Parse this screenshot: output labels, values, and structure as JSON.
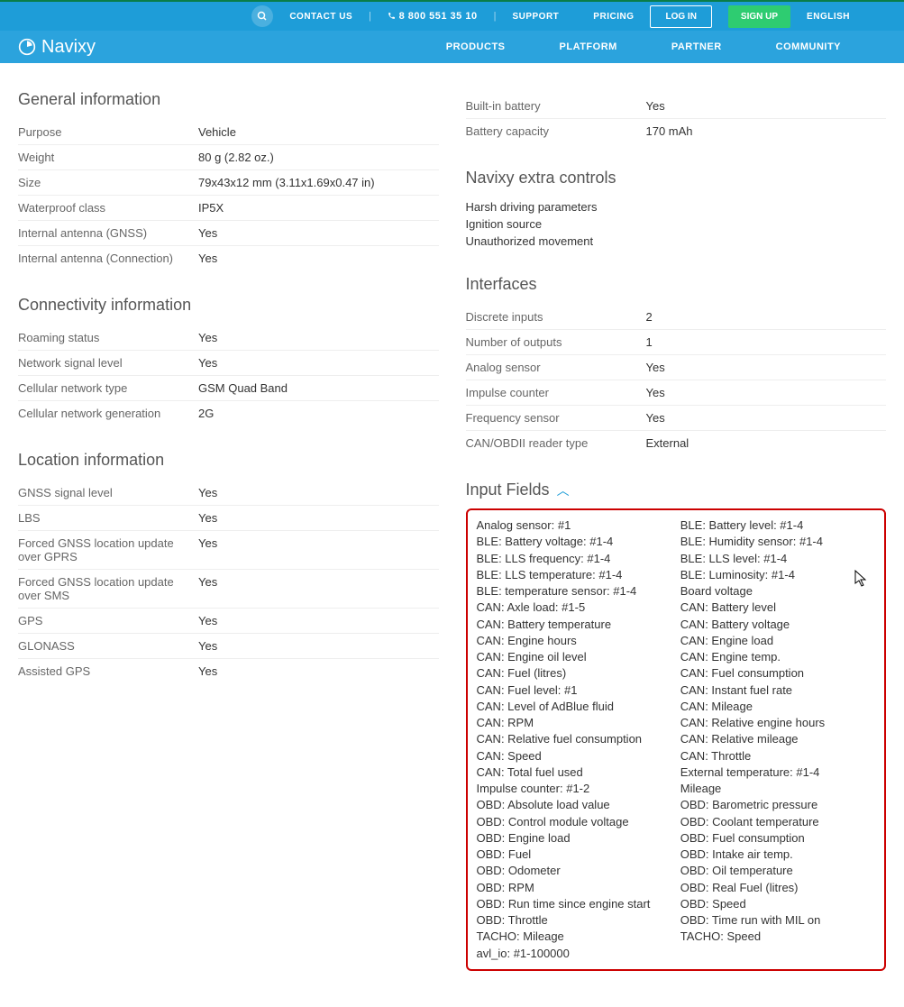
{
  "topbar": {
    "contact": "CONTACT US",
    "phone": "8 800 551 35 10",
    "support": "SUPPORT",
    "pricing": "PRICING",
    "login": "LOG IN",
    "signup": "SIGN UP",
    "language": "ENGLISH"
  },
  "logo": "Navixy",
  "nav": {
    "products": "PRODUCTS",
    "platform": "PLATFORM",
    "partner": "PARTNER",
    "community": "COMMUNITY"
  },
  "left": {
    "general_title": "General information",
    "general": [
      {
        "label": "Purpose",
        "value": "Vehicle"
      },
      {
        "label": "Weight",
        "value": "80 g (2.82 oz.)"
      },
      {
        "label": "Size",
        "value": "79x43x12 mm (3.11x1.69x0.47 in)"
      },
      {
        "label": "Waterproof class",
        "value": "IP5X"
      },
      {
        "label": "Internal antenna (GNSS)",
        "value": "Yes"
      },
      {
        "label": "Internal antenna (Connection)",
        "value": "Yes"
      }
    ],
    "connectivity_title": "Connectivity information",
    "connectivity": [
      {
        "label": "Roaming status",
        "value": "Yes"
      },
      {
        "label": "Network signal level",
        "value": "Yes"
      },
      {
        "label": "Cellular network type",
        "value": "GSM Quad Band"
      },
      {
        "label": "Cellular network generation",
        "value": "2G"
      }
    ],
    "location_title": "Location information",
    "location": [
      {
        "label": "GNSS signal level",
        "value": "Yes"
      },
      {
        "label": "LBS",
        "value": "Yes"
      },
      {
        "label": "Forced GNSS location update over GPRS",
        "value": "Yes"
      },
      {
        "label": "Forced GNSS location update over SMS",
        "value": "Yes"
      },
      {
        "label": "GPS",
        "value": "Yes"
      },
      {
        "label": "GLONASS",
        "value": "Yes"
      },
      {
        "label": "Assisted GPS",
        "value": "Yes"
      }
    ]
  },
  "right": {
    "battery": [
      {
        "label": "Built-in battery",
        "value": "Yes"
      },
      {
        "label": "Battery capacity",
        "value": "170 mAh"
      }
    ],
    "extra_title": "Navixy extra controls",
    "extra": [
      "Harsh driving parameters",
      "Ignition source",
      "Unauthorized movement"
    ],
    "interfaces_title": "Interfaces",
    "interfaces": [
      {
        "label": "Discrete inputs",
        "value": "2"
      },
      {
        "label": "Number of outputs",
        "value": "1"
      },
      {
        "label": "Analog sensor",
        "value": "Yes"
      },
      {
        "label": "Impulse counter",
        "value": "Yes"
      },
      {
        "label": "Frequency sensor",
        "value": "Yes"
      },
      {
        "label": "CAN/OBDII reader type",
        "value": "External"
      }
    ],
    "input_fields_title": "Input Fields",
    "input_fields": [
      "Analog sensor: #1",
      "BLE: Battery level: #1-4",
      "BLE: Battery voltage: #1-4",
      "BLE: Humidity sensor: #1-4",
      "BLE: LLS frequency: #1-4",
      "BLE: LLS level: #1-4",
      "BLE: LLS temperature: #1-4",
      "BLE: Luminosity: #1-4",
      "BLE: temperature sensor: #1-4",
      "Board voltage",
      "CAN: Axle load: #1-5",
      "CAN: Battery level",
      "CAN: Battery temperature",
      "CAN: Battery voltage",
      "CAN: Engine hours",
      "CAN: Engine load",
      "CAN: Engine oil level",
      "CAN: Engine temp.",
      "CAN: Fuel (litres)",
      "CAN: Fuel consumption",
      "CAN: Fuel level: #1",
      "CAN: Instant fuel rate",
      "CAN: Level of AdBlue fluid",
      "CAN: Mileage",
      "CAN: RPM",
      "CAN: Relative engine hours",
      "CAN: Relative fuel consumption",
      "CAN: Relative mileage",
      "CAN: Speed",
      "CAN: Throttle",
      "CAN: Total fuel used",
      "External temperature: #1-4",
      "Impulse counter: #1-2",
      "Mileage",
      "OBD: Absolute load value",
      "OBD: Barometric pressure",
      "OBD: Control module voltage",
      "OBD: Coolant temperature",
      "OBD: Engine load",
      "OBD: Fuel consumption",
      "OBD: Fuel",
      "OBD: Intake air temp.",
      "OBD: Odometer",
      "OBD: Oil temperature",
      "OBD: RPM",
      "OBD: Real Fuel (litres)",
      "OBD: Run time since engine start",
      "OBD: Speed",
      "OBD: Throttle",
      "OBD: Time run with MIL on",
      "TACHO: Mileage",
      "TACHO: Speed",
      "avl_io: #1-100000"
    ]
  }
}
